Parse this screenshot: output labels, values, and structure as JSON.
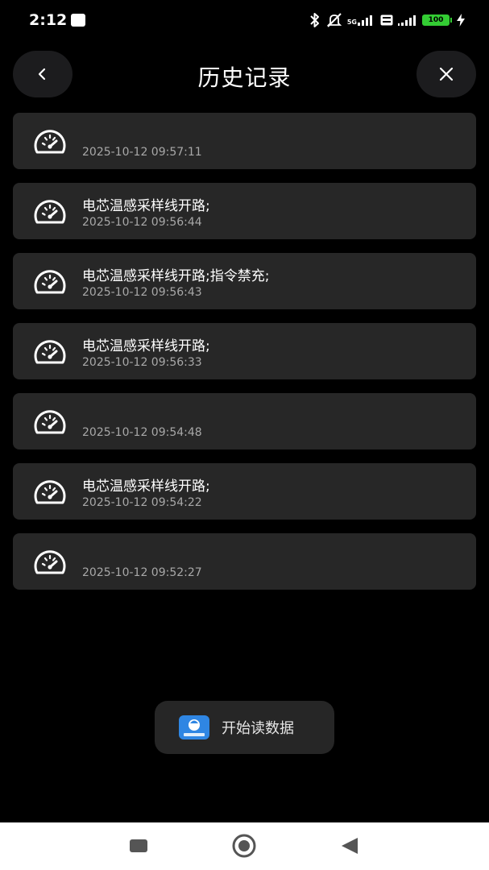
{
  "status_bar": {
    "time": "2:12",
    "network": "5G",
    "battery": "100",
    "icons": [
      "bluetooth-icon",
      "silent-icon",
      "signal-icon",
      "volte-icon",
      "battery-icon",
      "charging-icon"
    ]
  },
  "header": {
    "title": "历史记录",
    "back_icon": "chevron-left-icon",
    "close_icon": "close-icon"
  },
  "records": [
    {
      "message": "",
      "time": "2025-10-12 09:57:11",
      "icon": "speedometer-icon"
    },
    {
      "message": "电芯温感采样线开路;",
      "time": "2025-10-12 09:56:44",
      "icon": "speedometer-icon"
    },
    {
      "message": "电芯温感采样线开路;指令禁充;",
      "time": "2025-10-12 09:56:43",
      "icon": "speedometer-icon"
    },
    {
      "message": "电芯温感采样线开路;",
      "time": "2025-10-12 09:56:33",
      "icon": "speedometer-icon"
    },
    {
      "message": "",
      "time": "2025-10-12 09:54:48",
      "icon": "speedometer-icon"
    },
    {
      "message": "电芯温感采样线开路;",
      "time": "2025-10-12 09:54:22",
      "icon": "speedometer-icon"
    },
    {
      "message": "",
      "time": "2025-10-12 09:52:27",
      "icon": "speedometer-icon"
    }
  ],
  "toast": {
    "text": "开始读数据",
    "icon": "app-logo-icon"
  },
  "nav_bar": {
    "icons": [
      "recents-icon",
      "home-icon",
      "back-triangle-icon"
    ]
  },
  "colors": {
    "background": "#000000",
    "card": "#272727",
    "header_button": "#1c1c1e",
    "secondary_text": "#a8a8a8",
    "battery": "#33cc33",
    "app_logo": "#2f86e3"
  }
}
